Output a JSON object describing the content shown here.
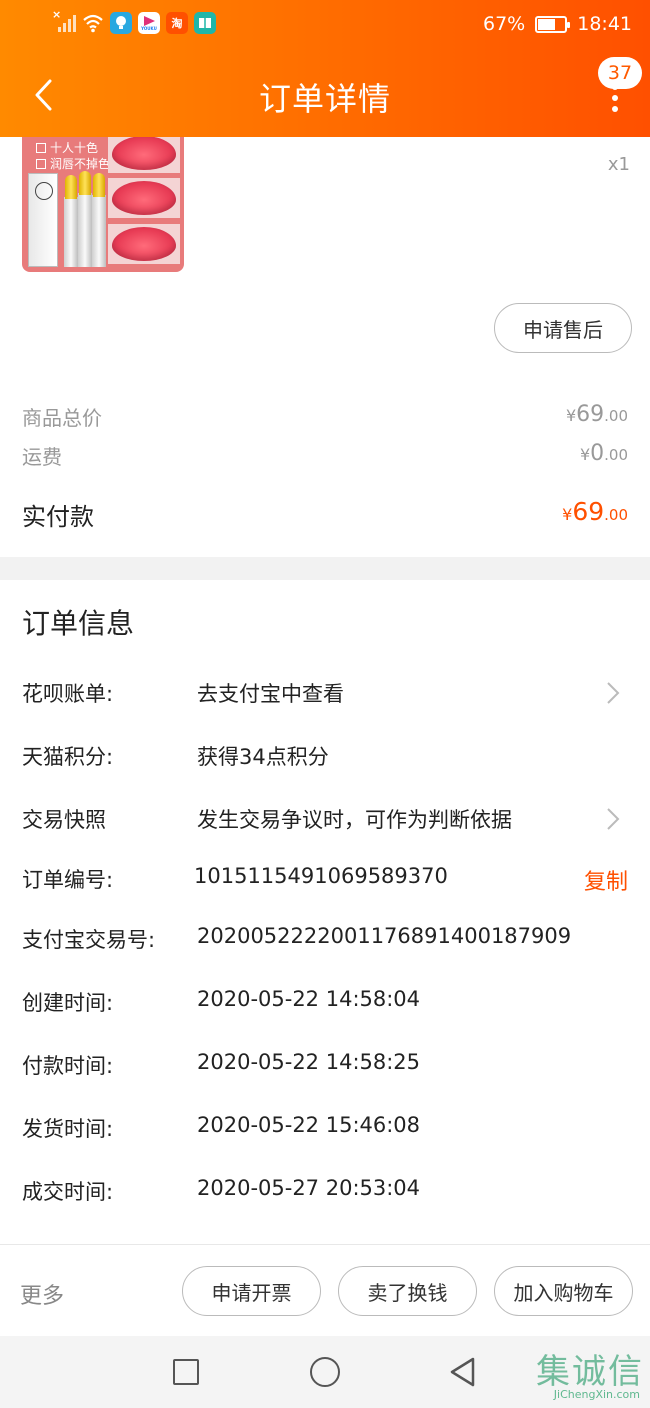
{
  "status_bar": {
    "battery": "67%",
    "time": "18:41",
    "app_icons": [
      "wifi-icon",
      "bulb-app-icon",
      "youku-app-icon",
      "taobao-app-icon",
      "book-app-icon"
    ],
    "taobao_label": "淘",
    "youku_label": "YOUKU",
    "battery_level": 0.67
  },
  "header": {
    "title": "订单详情",
    "badge_count": "37"
  },
  "product": {
    "quantity": "x1",
    "thumbnail_lines": [
      "十人十色",
      "润唇不掉色"
    ],
    "after_sale_button": "申请售后"
  },
  "price": {
    "goods_total_label": "商品总价",
    "goods_total": {
      "currency": "¥",
      "int": "69",
      "dec": ".00"
    },
    "shipping_label": "运费",
    "shipping": {
      "currency": "¥",
      "int": "0",
      "dec": ".00"
    },
    "paid_label": "实付款",
    "paid": {
      "currency": "¥",
      "int": "69",
      "dec": ".00"
    }
  },
  "order_info": {
    "title": "订单信息",
    "rows": [
      {
        "key": "花呗账单:",
        "value": "去支付宝中查看"
      },
      {
        "key": "天猫积分:",
        "value": "获得34点积分"
      },
      {
        "key": "交易快照",
        "value": "发生交易争议时，可作为判断依据"
      },
      {
        "key": "订单编号:",
        "value": "1015115491069589370",
        "action": "复制"
      },
      {
        "key": "支付宝交易号:",
        "value": "2020052222001176891400187909"
      },
      {
        "key": "创建时间:",
        "value": "2020-05-22 14:58:04"
      },
      {
        "key": "付款时间:",
        "value": "2020-05-22 14:58:25"
      },
      {
        "key": "发货时间:",
        "value": "2020-05-22 15:46:08"
      },
      {
        "key": "成交时间:",
        "value": "2020-05-27 20:53:04"
      }
    ]
  },
  "bottom_bar": {
    "more": "更多",
    "invoice_button": "申请开票",
    "resell_button": "卖了换钱",
    "add_cart_button": "加入购物车"
  },
  "watermark": {
    "chinese": "集诚信",
    "url": "JiChengXin.com"
  },
  "colors": {
    "header_start": "#ff8a00",
    "header_end": "#ff5000",
    "accent": "#ff5000"
  }
}
